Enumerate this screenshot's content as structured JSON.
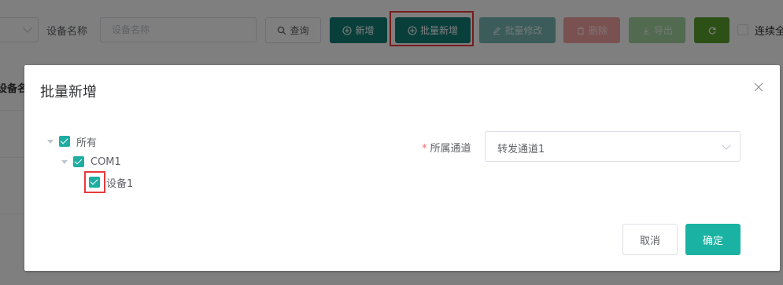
{
  "toolbar": {
    "device_name_label": "设备名称",
    "device_name_placeholder": "设备名称",
    "query_label": "查询",
    "add_label": "新增",
    "batch_add_label": "批量新增",
    "batch_edit_label": "批量修改",
    "delete_label": "删除",
    "export_label": "导出",
    "continuous_label": "连续全"
  },
  "table": {
    "header_partial": "设备名"
  },
  "dialog": {
    "title": "批量新增",
    "tree": [
      {
        "label": "所有",
        "checked": true,
        "expanded": true,
        "level": 0
      },
      {
        "label": "COM1",
        "checked": true,
        "expanded": true,
        "level": 1
      },
      {
        "label": "设备1",
        "checked": true,
        "level": 2
      }
    ],
    "channel_field": {
      "required_mark": "*",
      "label": "所属通道",
      "value": "转发通道1"
    },
    "cancel_label": "取消",
    "confirm_label": "确定"
  },
  "colors": {
    "primary_teal": "#127f77",
    "checkbox_teal": "#1fada2",
    "confirm_teal": "#1ab3a3",
    "highlight_red": "#e8393b",
    "refresh_green": "#5ba02c"
  }
}
